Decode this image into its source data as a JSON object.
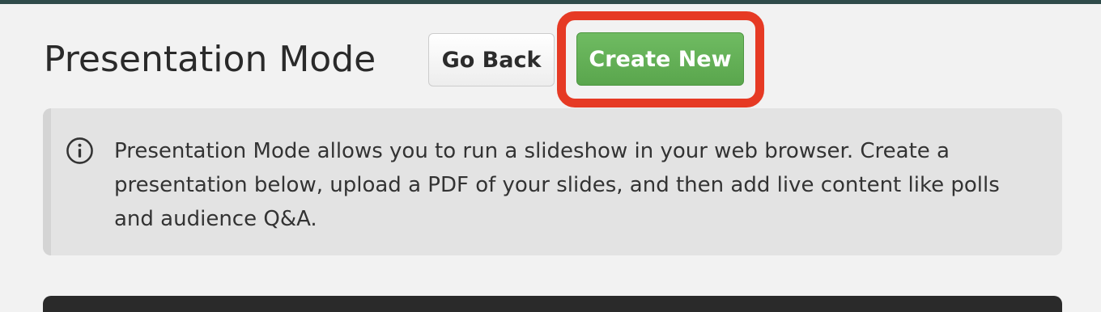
{
  "header": {
    "title": "Presentation Mode",
    "go_back_label": "Go Back",
    "create_new_label": "Create New"
  },
  "info": {
    "icon": "info-icon",
    "text": "Presentation Mode allows you to run a slideshow in your web browser. Create a presentation below, upload a PDF of your slides, and then add live content like polls and audience Q&A."
  },
  "colors": {
    "create_button": "#5fae52",
    "highlight": "#e63a24",
    "top_strip": "#2f4b4a"
  }
}
